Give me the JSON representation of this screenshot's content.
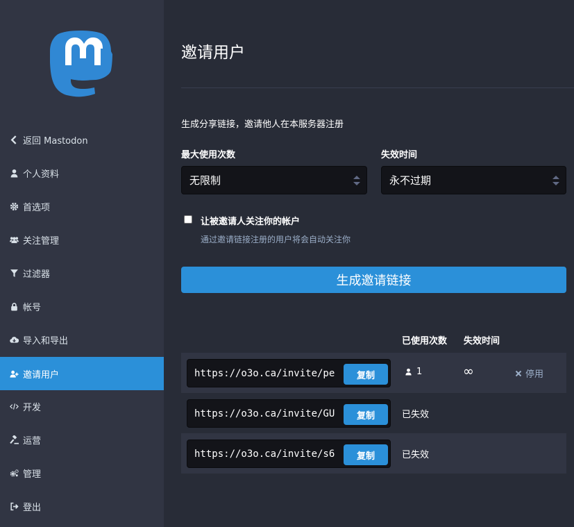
{
  "sidebar": {
    "items": [
      {
        "label": "返回 Mastodon",
        "icon": "chevron-left-icon"
      },
      {
        "label": "个人资料",
        "icon": "user-icon"
      },
      {
        "label": "首选项",
        "icon": "gear-icon"
      },
      {
        "label": "关注管理",
        "icon": "users-icon"
      },
      {
        "label": "过滤器",
        "icon": "filter-icon"
      },
      {
        "label": "帐号",
        "icon": "lock-icon"
      },
      {
        "label": "导入和导出",
        "icon": "cloud-download-icon"
      },
      {
        "label": "邀请用户",
        "icon": "user-plus-icon",
        "active": true
      },
      {
        "label": "开发",
        "icon": "code-icon"
      },
      {
        "label": "运营",
        "icon": "gavel-icon"
      },
      {
        "label": "管理",
        "icon": "cogs-icon"
      },
      {
        "label": "登出",
        "icon": "sign-out-icon"
      }
    ]
  },
  "main": {
    "title": "邀请用户",
    "hint": "生成分享链接，邀请他人在本服务器注册",
    "max_uses": {
      "label": "最大使用次数",
      "value": "无限制"
    },
    "expires": {
      "label": "失效时间",
      "value": "永不过期"
    },
    "autofollow": {
      "label": "让被邀请人关注你的帐户",
      "hint": "通过邀请链接注册的用户将会自动关注你",
      "checked": false
    },
    "generate_button": "生成邀请链接",
    "table": {
      "headers": {
        "uses": "已使用次数",
        "expires": "失效时间"
      },
      "rows": [
        {
          "url": "https://o3o.ca/invite/pe",
          "copy": "复制",
          "uses": "1",
          "expires": "∞",
          "action": "停用"
        },
        {
          "url": "https://o3o.ca/invite/GU",
          "copy": "复制",
          "status": "已失效"
        },
        {
          "url": "https://o3o.ca/invite/s6",
          "copy": "复制",
          "status": "已失效"
        }
      ]
    }
  },
  "colors": {
    "accent": "#2b90d9",
    "sidebar": "#313543",
    "background": "#282c37"
  }
}
